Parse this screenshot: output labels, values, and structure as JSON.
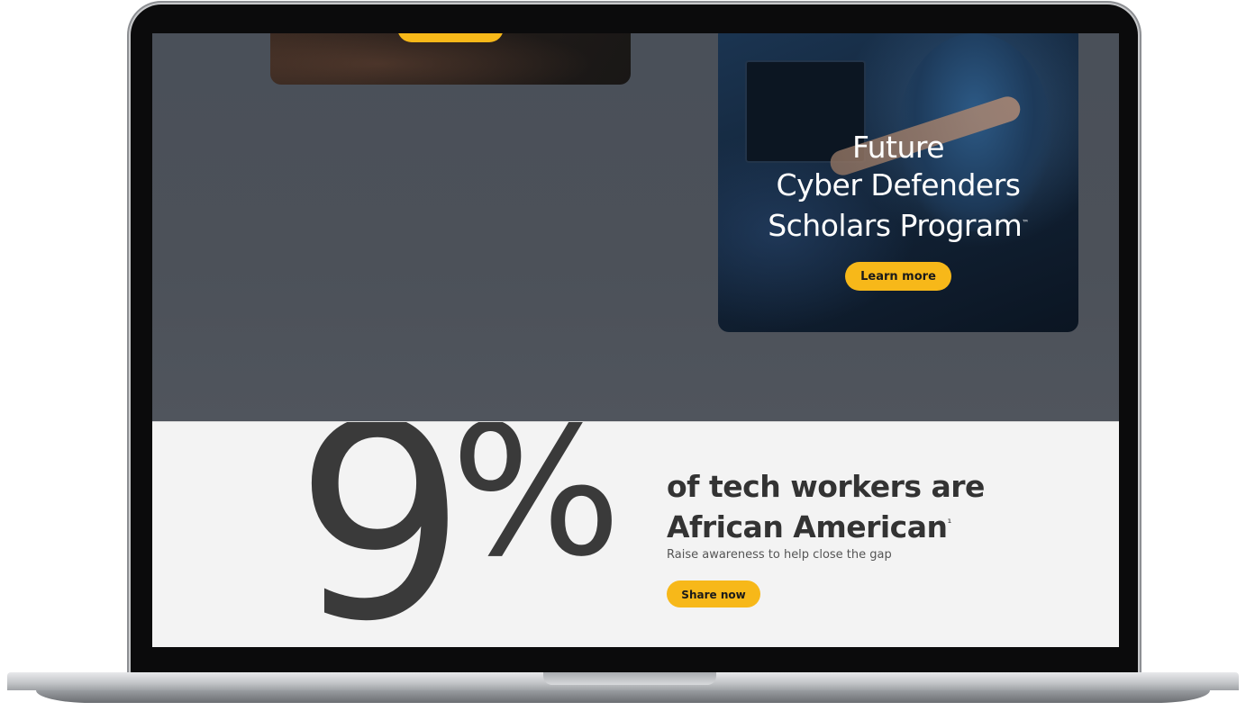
{
  "promo_card": {
    "title_line1": "Future",
    "title_line2": "Cyber Defenders",
    "title_line3": "Scholars Program",
    "trademark": "™",
    "button_label": "Learn more"
  },
  "stat_section": {
    "stat_number": "9",
    "stat_unit": "%",
    "headline_line1": "of tech workers are",
    "headline_line2": "African American",
    "footnote_mark": "¹",
    "subline": "Raise awareness to help close the gap",
    "button_label": "Share now"
  },
  "colors": {
    "accent": "#f7b819",
    "dark_band": "#4b5058",
    "light_band": "#f3f3f3",
    "text_dark": "#333333"
  }
}
